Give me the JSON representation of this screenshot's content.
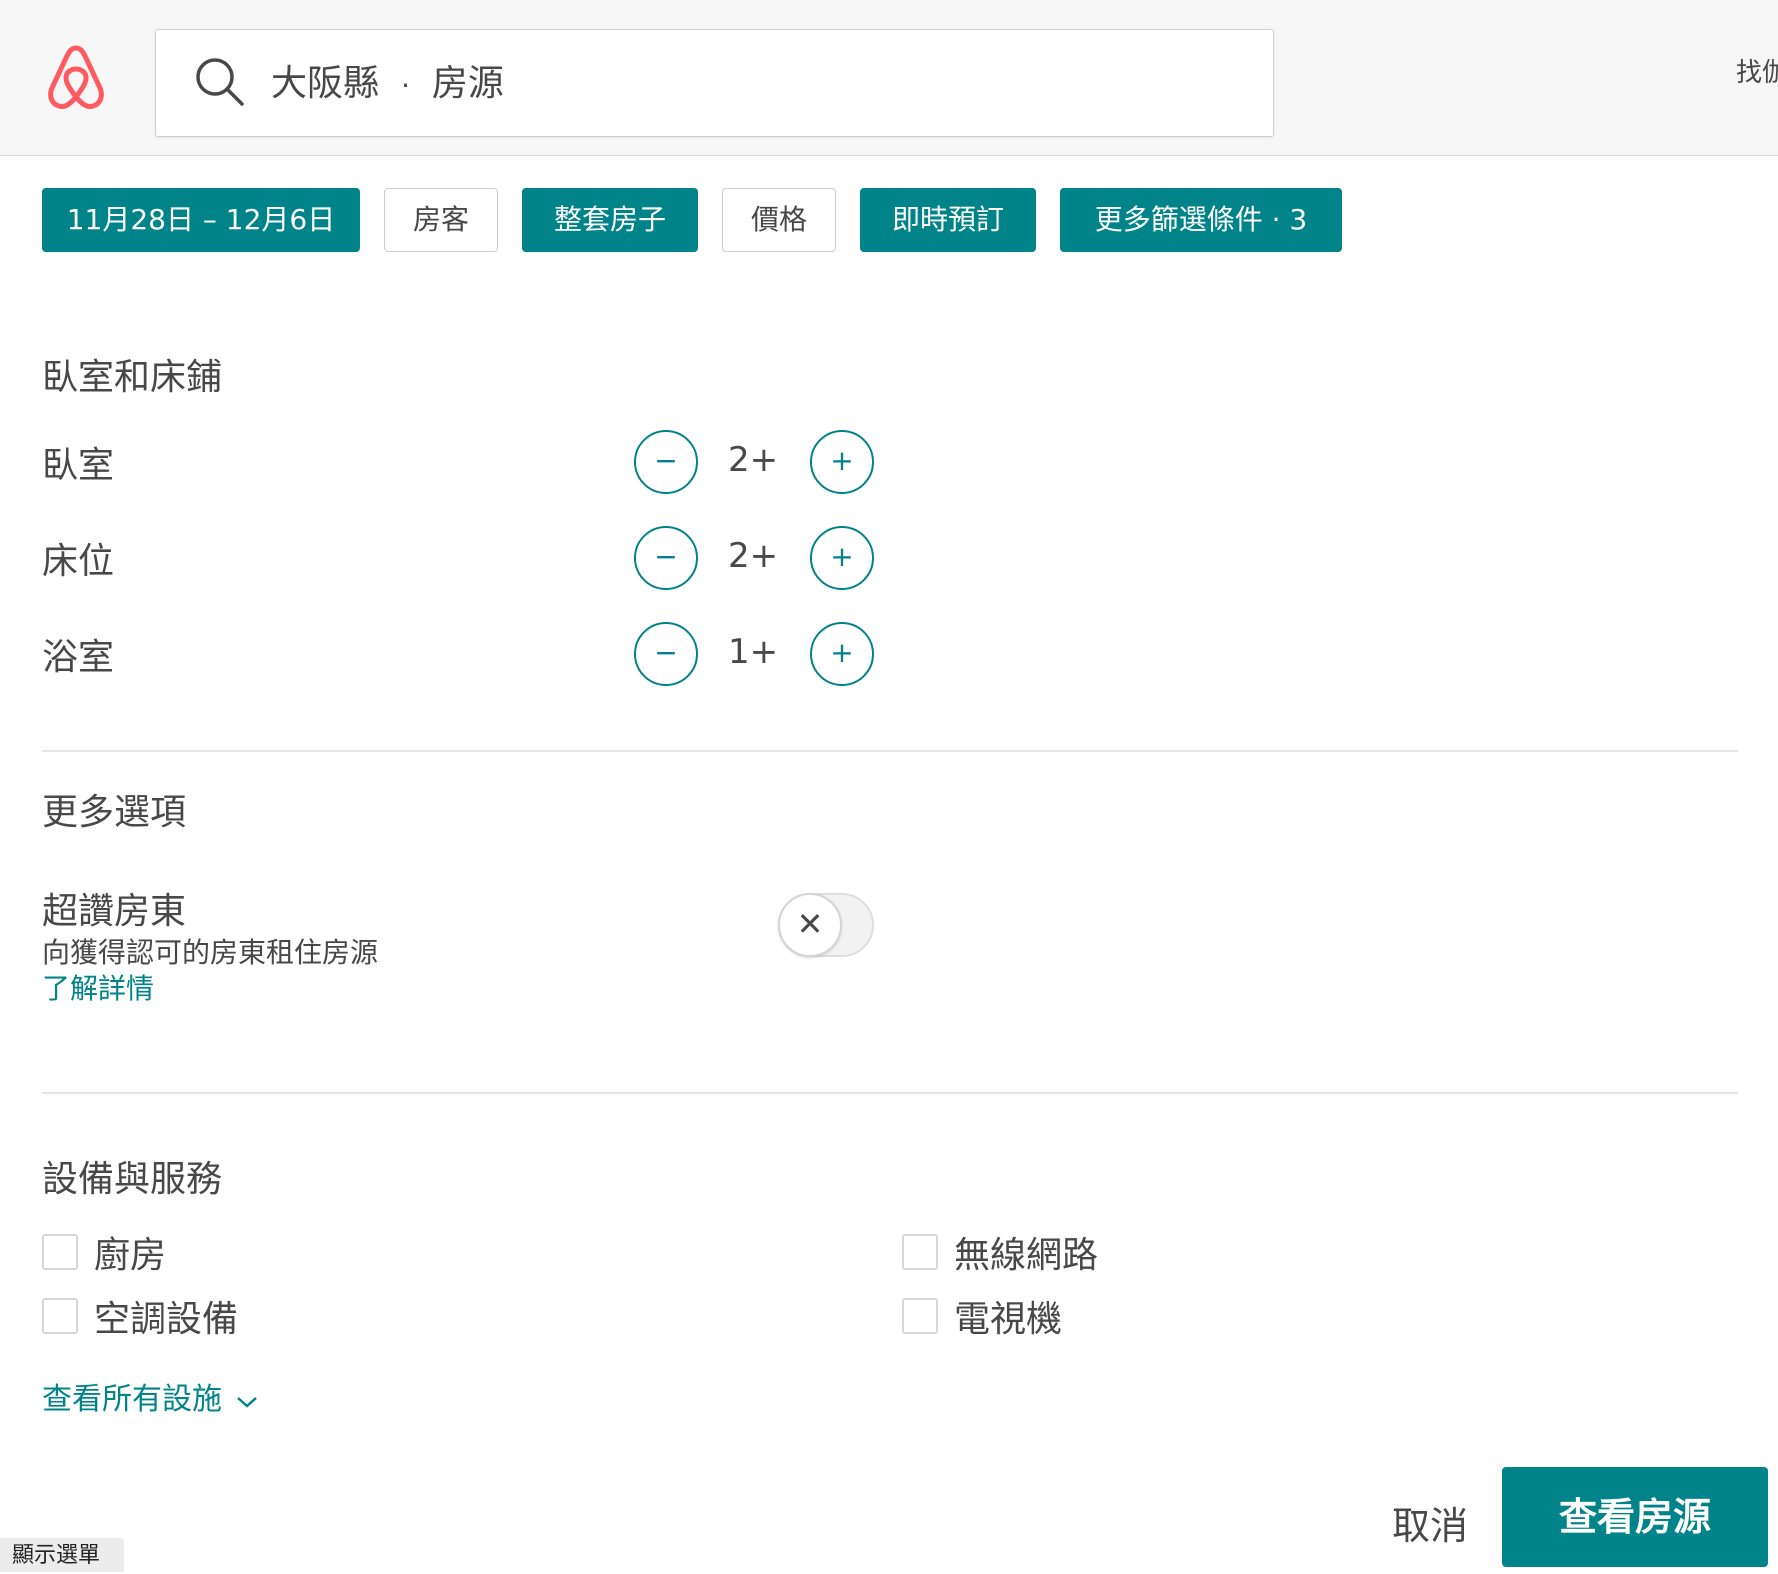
{
  "header": {
    "search_location": "大阪縣",
    "search_separator": "·",
    "search_type": "房源",
    "right_text": "找伽"
  },
  "filters": [
    {
      "label": "11月28日 – 12月6日",
      "active": true
    },
    {
      "label": "房客",
      "active": false
    },
    {
      "label": "整套房子",
      "active": true
    },
    {
      "label": "價格",
      "active": false
    },
    {
      "label": "即時預訂",
      "active": true
    },
    {
      "label": "更多篩選條件 · 3",
      "active": true
    }
  ],
  "rooms": {
    "title": "臥室和床鋪",
    "rows": [
      {
        "label": "臥室",
        "value": "2+",
        "minus": "−",
        "plus": "+"
      },
      {
        "label": "床位",
        "value": "2+",
        "minus": "−",
        "plus": "+"
      },
      {
        "label": "浴室",
        "value": "1+",
        "minus": "−",
        "plus": "+"
      }
    ]
  },
  "more_options": {
    "title": "更多選項",
    "superhost_title": "超讚房東",
    "superhost_subtitle": "向獲得認可的房東租住房源",
    "learn_more": "了解詳情",
    "toggle_icon": "✕",
    "toggle_on": false
  },
  "amenities": {
    "title": "設備與服務",
    "items": [
      {
        "label": "廚房",
        "checked": false
      },
      {
        "label": "無線網路",
        "checked": false
      },
      {
        "label": "空調設備",
        "checked": false
      },
      {
        "label": "電視機",
        "checked": false
      }
    ],
    "see_all": "查看所有設施",
    "see_all_icon": "chevron-down-icon"
  },
  "footer": {
    "cancel": "取消",
    "submit": "查看房源",
    "menu_tab": "顯示選單"
  },
  "colors": {
    "accent": "#008489",
    "brand": "#FF5A5F",
    "text": "#484848"
  }
}
